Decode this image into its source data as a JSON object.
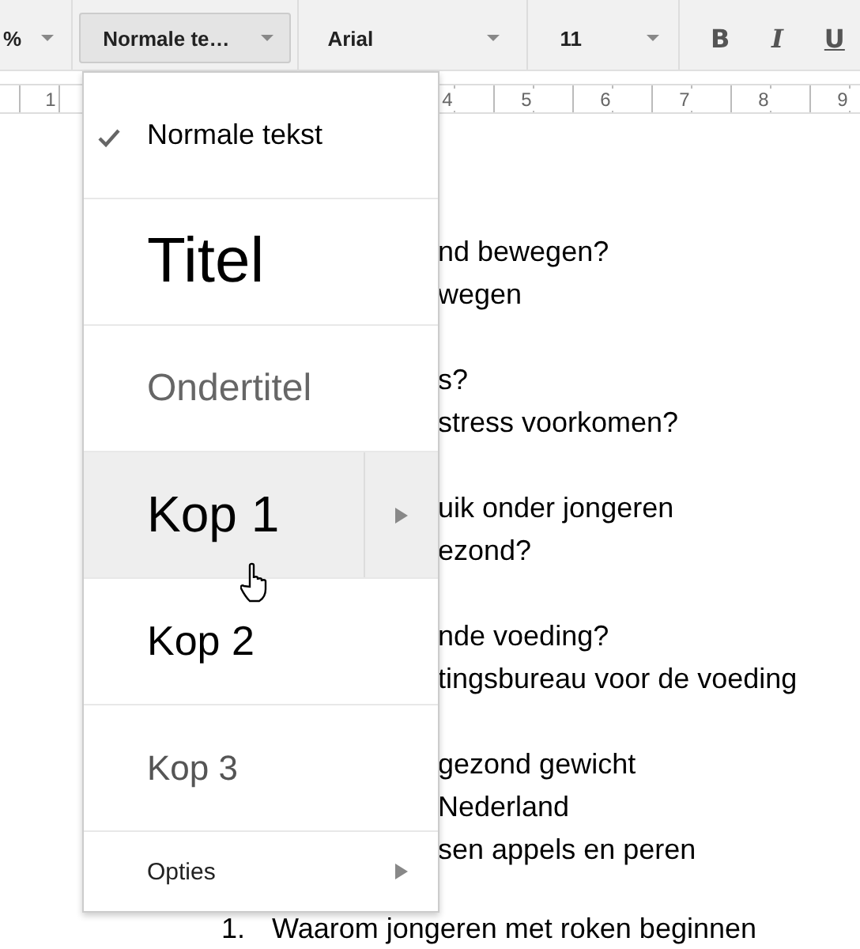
{
  "toolbar": {
    "zoom": {
      "value": "%"
    },
    "style_select": {
      "value": "Normale te…",
      "open": true
    },
    "font_select": {
      "value": "Arial"
    },
    "size_select": {
      "value": "11"
    },
    "format_buttons": [
      {
        "kind": "bold",
        "label": "B"
      },
      {
        "kind": "italic",
        "label": "I"
      },
      {
        "kind": "underline",
        "label": "U"
      }
    ]
  },
  "ruler": {
    "labels": [
      "1",
      "4",
      "5",
      "6",
      "7",
      "8",
      "9"
    ]
  },
  "style_menu": {
    "items": [
      {
        "kind": "normal",
        "label": "Normale tekst",
        "checked": true,
        "hovered": false,
        "has_submenu": false
      },
      {
        "kind": "title",
        "label": "Titel",
        "checked": false,
        "hovered": false,
        "has_submenu": false
      },
      {
        "kind": "subtitle",
        "label": "Ondertitel",
        "checked": false,
        "hovered": false,
        "has_submenu": false
      },
      {
        "kind": "heading1",
        "label": "Kop 1",
        "checked": false,
        "hovered": true,
        "has_submenu": true
      },
      {
        "kind": "heading2",
        "label": "Kop 2",
        "checked": false,
        "hovered": false,
        "has_submenu": false
      },
      {
        "kind": "heading3",
        "label": "Kop 3",
        "checked": false,
        "hovered": false,
        "has_submenu": false
      },
      {
        "kind": "options",
        "label": "Opties",
        "checked": false,
        "hovered": false,
        "has_submenu": true
      }
    ]
  },
  "document": {
    "paragraphs": [
      [
        "nd bewegen?",
        "wegen"
      ],
      [
        "s?",
        "stress voorkomen?"
      ],
      [
        "uik onder jongeren",
        "ezond?"
      ],
      [
        "nde voeding?",
        "tingsbureau voor de voeding"
      ],
      [
        "gezond gewicht",
        "Nederland",
        "sen appels en peren"
      ]
    ],
    "list_item": {
      "number": "1.",
      "text": "Waarom jongeren met roken beginnen"
    }
  }
}
